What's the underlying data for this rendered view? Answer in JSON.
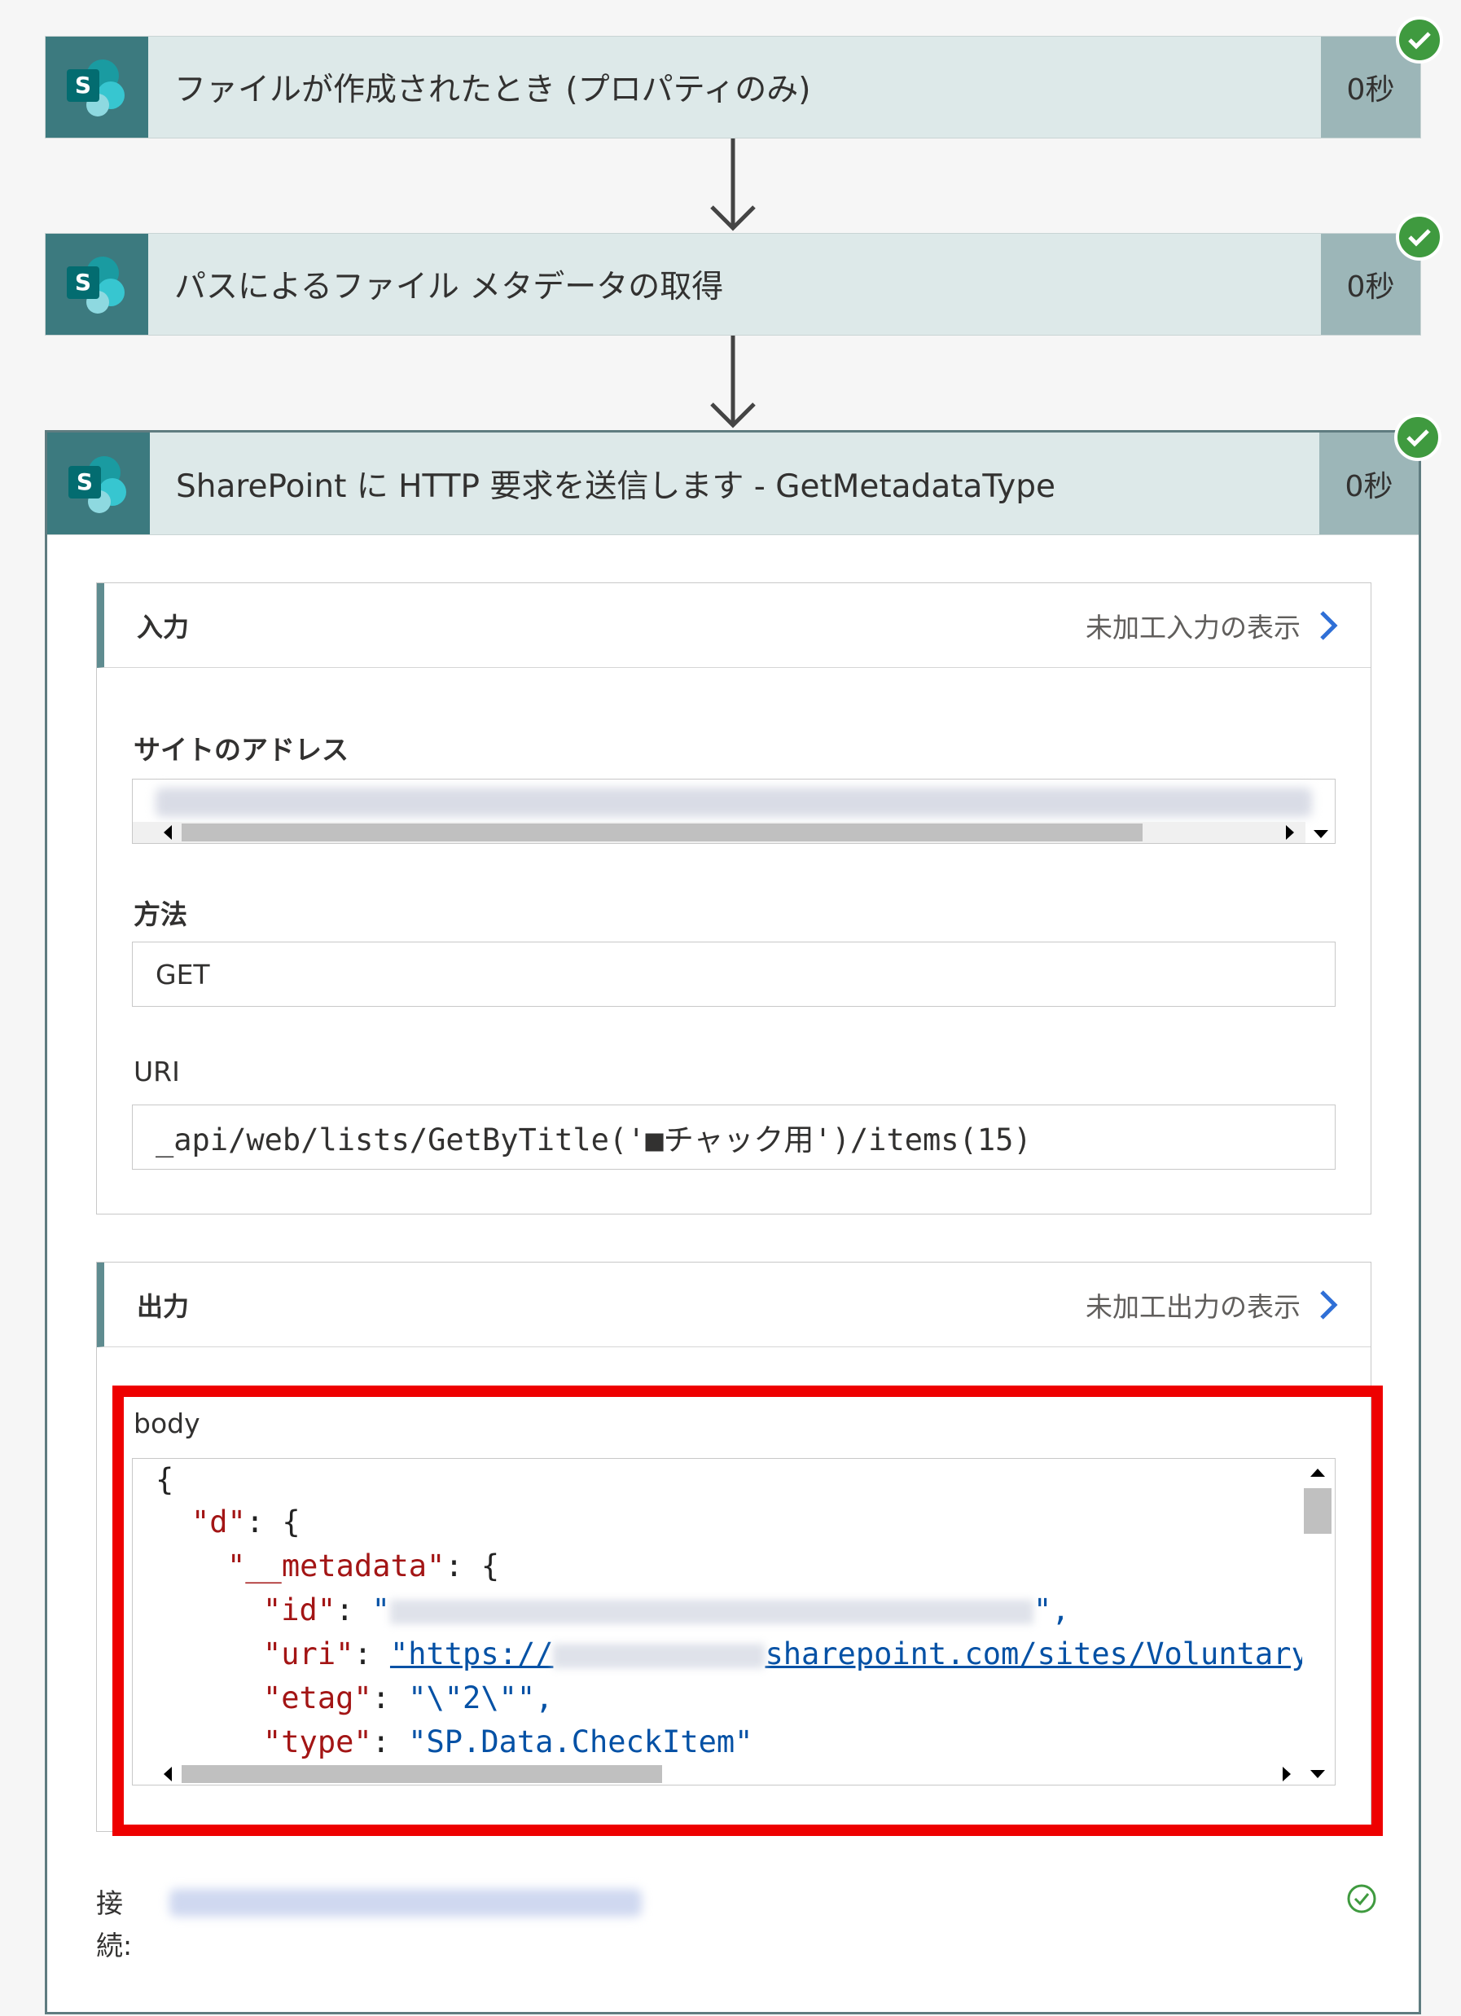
{
  "steps": [
    {
      "title": "ファイルが作成されたとき (プロパティのみ)",
      "duration": "0秒"
    },
    {
      "title": "パスによるファイル メタデータの取得",
      "duration": "0秒"
    },
    {
      "title": "SharePoint に HTTP 要求を送信します - GetMetadataType",
      "duration": "0秒"
    }
  ],
  "input": {
    "header": "入力",
    "raw_link": "未加工入力の表示",
    "site_label": "サイトのアドレス",
    "method_label": "方法",
    "method_value": "GET",
    "uri_label": "URI",
    "uri_value": "_api/web/lists/GetByTitle('■チャック用')/items(15)"
  },
  "output": {
    "header": "出力",
    "raw_link": "未加工出力の表示",
    "body_label": "body",
    "code": {
      "open": "{",
      "d_key": "\"d\"",
      "d_rest": ": {",
      "meta_key": "\"__metadata\"",
      "meta_rest": ": {",
      "id_key": "\"id\"",
      "id_colon": ": ",
      "id_open": "\"",
      "id_close": "\",",
      "uri_key": "\"uri\"",
      "uri_colon": ": ",
      "uri_prefix": "\"https://",
      "uri_suffix": "sharepoint.com/sites/VoluntaryIns",
      "etag_key": "\"etag\"",
      "etag_colon": ": ",
      "etag_value": "\"\\\"2\\\"\",",
      "type_key": "\"type\"",
      "type_colon": ": ",
      "type_value": "\"SP.Data.CheckItem\""
    }
  },
  "connection_label": "接\n続:"
}
